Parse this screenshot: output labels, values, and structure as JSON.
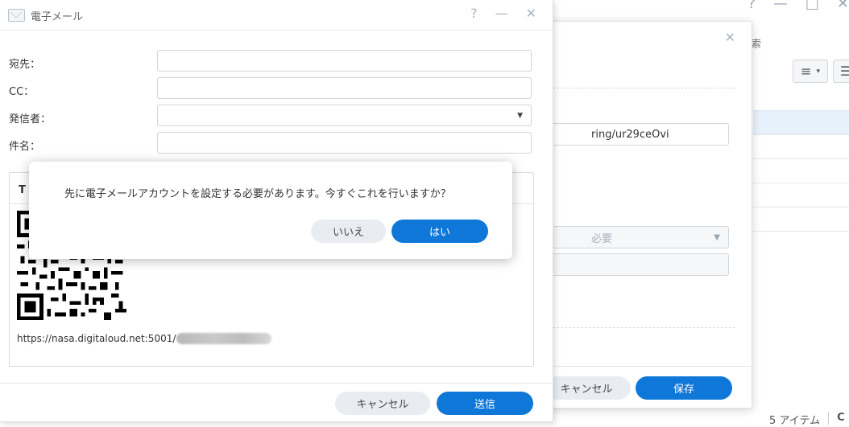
{
  "background_app": {
    "search_fragment": "索",
    "status_items": "5 アイテム",
    "status_trailing": "C"
  },
  "share_dialog": {
    "link_suffix": "ring/ur29ceOvi",
    "select_placeholder": "必要",
    "cancel_label": "キャンセル",
    "save_label": "保存"
  },
  "email_dialog": {
    "title": "電子メール",
    "controls": {
      "help": "?",
      "minimize": "—",
      "close": "✕"
    },
    "fields": [
      {
        "label": "宛先：",
        "value": ""
      },
      {
        "label": "CC：",
        "value": ""
      },
      {
        "label": "発信者：",
        "value": ""
      },
      {
        "label": "件名：",
        "value": ""
      }
    ],
    "tab_label": "T",
    "share_url": "https://nasa.digitaloud.net:5001/",
    "cancel_label": "キャンセル",
    "send_label": "送信"
  },
  "confirm_dialog": {
    "message": "先に電子メールアカウントを設定する必要があります。今すぐこれを行いますか？",
    "no_label": "いいえ",
    "yes_label": "はい"
  },
  "colors": {
    "accent": "#0e77d8",
    "secondary_button": "#e9edf1",
    "selected_row": "#e7f1fb"
  }
}
